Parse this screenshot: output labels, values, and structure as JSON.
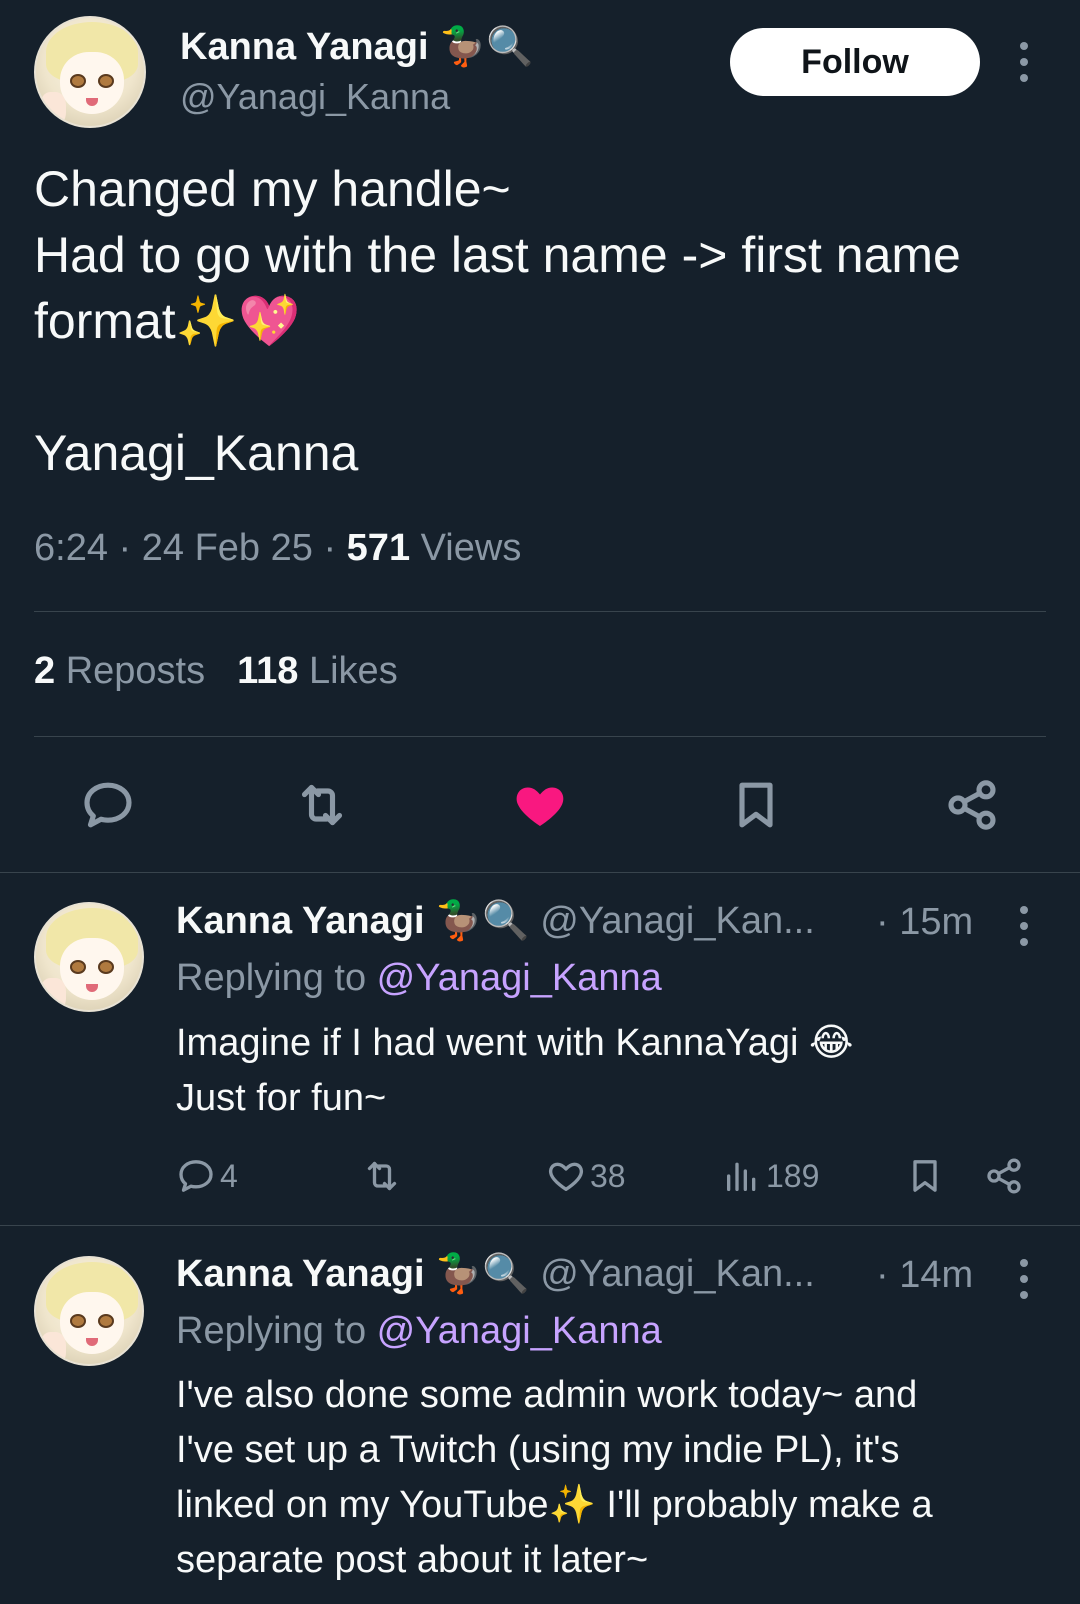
{
  "main_tweet": {
    "author": {
      "name": "Kanna Yanagi",
      "badge_emoji": "🦆🔍",
      "handle": "@Yanagi_Kanna"
    },
    "follow_label": "Follow",
    "text_lines": [
      "Changed my handle~",
      "Had to go with the last name -> first name",
      "format✨💖",
      "",
      "Yanagi_Kanna"
    ],
    "meta": {
      "time": "6:24",
      "sep1": " · ",
      "date": "24 Feb 25",
      "sep2": " · ",
      "views_count": "571",
      "views_label": " Views"
    },
    "stats": {
      "reposts_count": "2",
      "reposts_label": " Reposts",
      "likes_count": "118",
      "likes_label": " Likes"
    },
    "liked": true,
    "colors": {
      "like": "#f91880",
      "icon": "#8b98a5"
    }
  },
  "replies": [
    {
      "name": "Kanna Yanagi",
      "badge_emoji": "🦆🔍",
      "handle": "@Yanagi_Kan...",
      "time": "· 15m",
      "replying_prefix": "Replying to ",
      "replying_to": "@Yanagi_Kanna",
      "text_lines": [
        "Imagine if I had went with KannaYagi 😂",
        "Just for fun~"
      ],
      "actions": {
        "replies": "4",
        "reposts": "",
        "likes": "38",
        "views": "189"
      }
    },
    {
      "name": "Kanna Yanagi",
      "badge_emoji": "🦆🔍",
      "handle": "@Yanagi_Kan...",
      "time": "· 14m",
      "replying_prefix": "Replying to ",
      "replying_to": "@Yanagi_Kanna",
      "text_lines": [
        "I've also done some admin work today~ and",
        "I've set up a Twitch (using my indie PL), it's",
        "linked on my YouTube✨ I'll probably make a",
        "separate post about it later~"
      ]
    }
  ]
}
